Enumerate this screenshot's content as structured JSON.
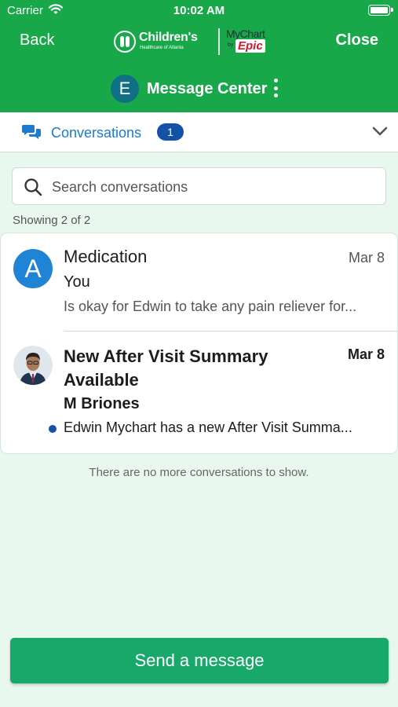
{
  "status_bar": {
    "carrier": "Carrier",
    "time": "10:02 AM"
  },
  "header": {
    "back_label": "Back",
    "close_label": "Close",
    "logo": {
      "childrens_name": "Children's",
      "childrens_sub": "Healthcare of Atlanta",
      "mychart": "MyChart",
      "by": "by",
      "epic": "Epic"
    },
    "avatar_initial": "E",
    "title": "Message Center"
  },
  "tabs": {
    "conversations_label": "Conversations",
    "count": "1"
  },
  "search": {
    "placeholder": "Search conversations"
  },
  "showing": "Showing 2 of 2",
  "conversations": [
    {
      "avatar": "A",
      "subject": "Medication",
      "date": "Mar 8",
      "from": "You",
      "preview": "Is okay for Edwin to take any pain reliever for...",
      "unread": false
    },
    {
      "avatar": "photo",
      "subject": "New After Visit Summary Available",
      "date": "Mar 8",
      "from": "M Briones",
      "preview": "Edwin Mychart has a new After Visit Summa...",
      "unread": true
    }
  ],
  "no_more": "There are no more conversations to show.",
  "send_button": "Send a message",
  "colors": {
    "brand_green": "#18a84a",
    "button_green": "#18a86a",
    "link_blue": "#1a7bd0",
    "badge_blue": "#1452a8"
  }
}
